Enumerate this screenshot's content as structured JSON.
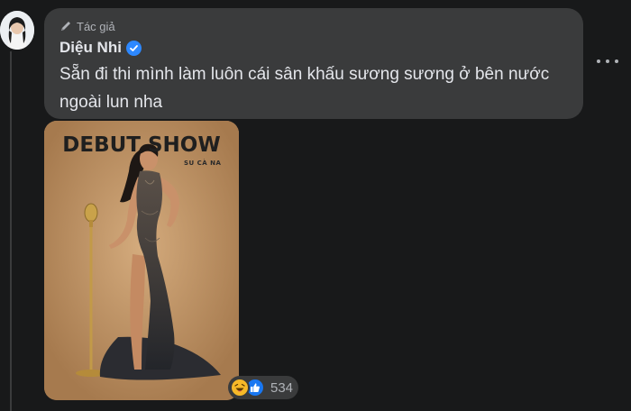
{
  "comment": {
    "author_badge": "Tác giả",
    "author_name": "Diệu Nhi",
    "text": "Sẵn đi thi mình làm luôn cái sân khấu sương sương ở bên nước ngoài lun nha",
    "reactions": {
      "icons": [
        "haha-icon",
        "like-icon"
      ],
      "count": "534"
    }
  },
  "photo": {
    "title": "DEBUT SHOW",
    "subtitle": "SU CÀ NA"
  },
  "colors": {
    "background": "#18191a",
    "bubble": "#3a3b3c",
    "primary_text": "#e4e6eb",
    "secondary_text": "#b0b3b8",
    "verified_blue": "#2d88ff",
    "like_blue": "#1877f2",
    "haha_yellow": "#f7b928"
  }
}
